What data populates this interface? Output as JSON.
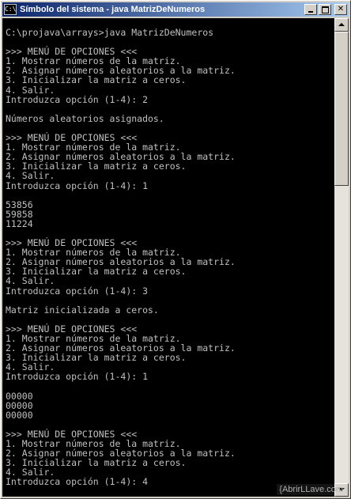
{
  "window": {
    "title": "Símbolo del sistema - java  MatrizDeNumeros",
    "icon": "C:\\",
    "icon_name": "command-prompt-icon",
    "buttons": [
      "minimize-icon",
      "maximize-icon",
      "close-icon"
    ],
    "close_glyph": "✕"
  },
  "console": {
    "text": "C:\\projava\\arrays>java MatrizDeNumeros\n\n>>> MENÚ DE OPCIONES <<<\n1. Mostrar números de la matriz.\n2. Asignar números aleatorios a la matriz.\n3. Inicializar la matriz a ceros.\n4. Salir.\nIntroduzca opción (1-4): 2\n\nNúmeros aleatorios asignados.\n\n>>> MENÚ DE OPCIONES <<<\n1. Mostrar números de la matriz.\n2. Asignar números aleatorios a la matriz.\n3. Inicializar la matriz a ceros.\n4. Salir.\nIntroduzca opción (1-4): 1\n\n53856\n59858\n11224\n\n>>> MENÚ DE OPCIONES <<<\n1. Mostrar números de la matriz.\n2. Asignar números aleatorios a la matriz.\n3. Inicializar la matriz a ceros.\n4. Salir.\nIntroduzca opción (1-4): 3\n\nMatriz inicializada a ceros.\n\n>>> MENÚ DE OPCIONES <<<\n1. Mostrar números de la matriz.\n2. Asignar números aleatorios a la matriz.\n3. Inicializar la matriz a ceros.\n4. Salir.\nIntroduzca opción (1-4): 1\n\n00000\n00000\n00000\n\n>>> MENÚ DE OPCIONES <<<\n1. Mostrar números de la matriz.\n2. Asignar números aleatorios a la matriz.\n3. Inicializar la matriz a ceros.\n4. Salir.\nIntroduzca opción (1-4): 4",
    "background": "#000000",
    "foreground": "#c0c0c0"
  },
  "watermark": "{AbrirLLave.com"
}
